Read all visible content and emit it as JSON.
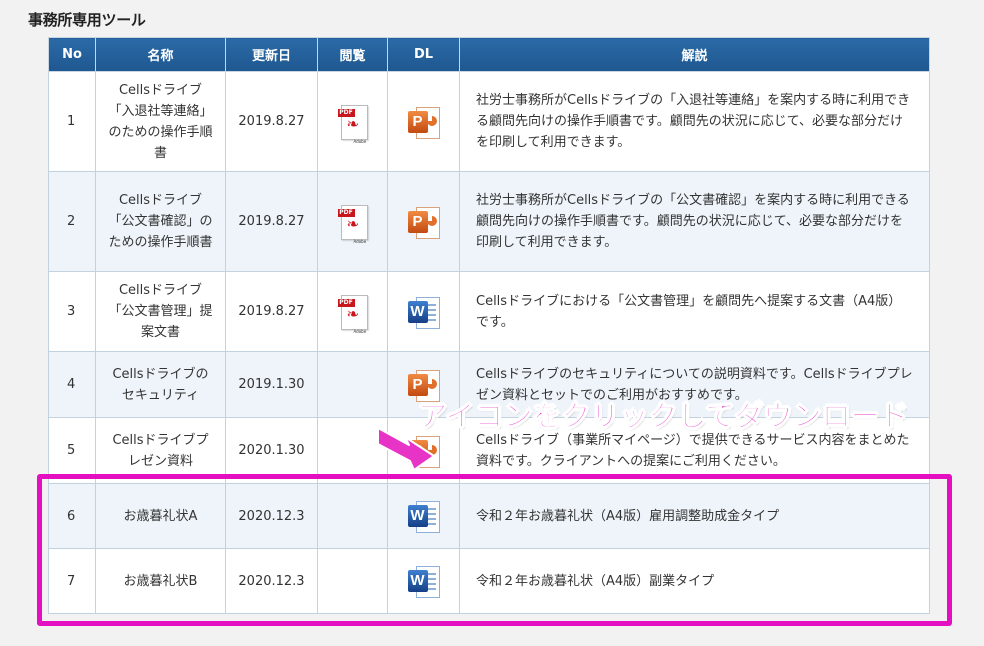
{
  "section_title": "事務所専用ツール",
  "columns": {
    "no": "No",
    "name": "名称",
    "date": "更新日",
    "view": "閲覧",
    "dl": "DL",
    "desc": "解説"
  },
  "rows": [
    {
      "no": "1",
      "name": "Cellsドライブ「入退社等連絡」のための操作手順書",
      "date": "2019.8.27",
      "view_icon": "pdf-icon",
      "dl_icon": "ppt-icon",
      "desc": "社労士事務所がCellsドライブの「入退社等連絡」を案内する時に利用できる顧問先向けの操作手順書です。顧問先の状況に応じて、必要な部分だけを印刷して利用できます。"
    },
    {
      "no": "2",
      "name": "Cellsドライブ「公文書確認」のための操作手順書",
      "date": "2019.8.27",
      "view_icon": "pdf-icon",
      "dl_icon": "ppt-icon",
      "desc": "社労士事務所がCellsドライブの「公文書確認」を案内する時に利用できる顧問先向けの操作手順書です。顧問先の状況に応じて、必要な部分だけを印刷して利用できます。"
    },
    {
      "no": "3",
      "name": "Cellsドライブ「公文書管理」提案文書",
      "date": "2019.8.27",
      "view_icon": "pdf-icon",
      "dl_icon": "word-icon",
      "desc": "Cellsドライブにおける「公文書管理」を顧問先へ提案する文書（A4版）です。"
    },
    {
      "no": "4",
      "name": "Cellsドライブのセキュリティ",
      "date": "2019.1.30",
      "view_icon": "",
      "dl_icon": "ppt-icon",
      "desc": "Cellsドライブのセキュリティについての説明資料です。Cellsドライブプレゼン資料とセットでのご利用がおすすめです。"
    },
    {
      "no": "5",
      "name": "Cellsドライブプレゼン資料",
      "date": "2020.1.30",
      "view_icon": "",
      "dl_icon": "ppt-icon",
      "desc": "Cellsドライブ（事業所マイページ）で提供できるサービス内容をまとめた資料です。クライアントへの提案にご利用ください。"
    },
    {
      "no": "6",
      "name": "お歳暮礼状A",
      "date": "2020.12.3",
      "view_icon": "",
      "dl_icon": "word-icon",
      "desc": "令和２年お歳暮礼状（A4版）雇用調整助成金タイプ"
    },
    {
      "no": "7",
      "name": "お歳暮礼状B",
      "date": "2020.12.3",
      "view_icon": "",
      "dl_icon": "word-icon",
      "desc": "令和２年お歳暮礼状（A4版）副業タイプ"
    }
  ],
  "icon_text": {
    "pdf_label": "PDF",
    "pdf_brand": "Adobe",
    "ppt_letter": "P",
    "word_letter": "W"
  },
  "annotation": "アイコンをクリックしてダウンロード",
  "colors": {
    "header_bg": "#1f5790",
    "annotation": "#e733c6",
    "highlight_border": "#e30fc0",
    "alt_row_bg": "#eef4fa"
  }
}
